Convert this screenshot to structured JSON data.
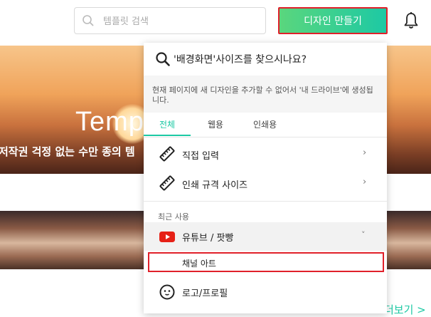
{
  "header": {
    "search_placeholder": "템플릿 검색",
    "make_design_label": "디자인 만들기"
  },
  "hero": {
    "title": "Temp",
    "subtitle": "저작권 걱정 없는 수만 종의 템",
    "more_link": "더보기 >"
  },
  "dropdown": {
    "question": "'배경화면'사이즈를 찾으시나요?",
    "notice": "현재 페이지에 새 디자인을 추가할 수 없어서 '내 드라이브'에 생성됩니다.",
    "tabs": [
      {
        "label": "전체",
        "active": true
      },
      {
        "label": "웹용",
        "active": false
      },
      {
        "label": "인쇄용",
        "active": false
      }
    ],
    "items": [
      {
        "label": "직접 입력",
        "icon": "ruler-icon"
      },
      {
        "label": "인쇄 규격 사이즈",
        "icon": "ruler-icon"
      }
    ],
    "recent_label": "최근 사용",
    "recent_group": {
      "label": "유튜브 / 팟빵",
      "icon": "youtube-icon",
      "expanded": true
    },
    "recent_sub_item": {
      "label": "채널 아트"
    },
    "logo_item": {
      "label": "로고/프로필",
      "icon": "smiley-icon"
    }
  },
  "colors": {
    "accent": "#1dc9a4",
    "gradient_start": "#5ad67d",
    "highlight_border": "#e0202a",
    "youtube_red": "#e62117"
  }
}
